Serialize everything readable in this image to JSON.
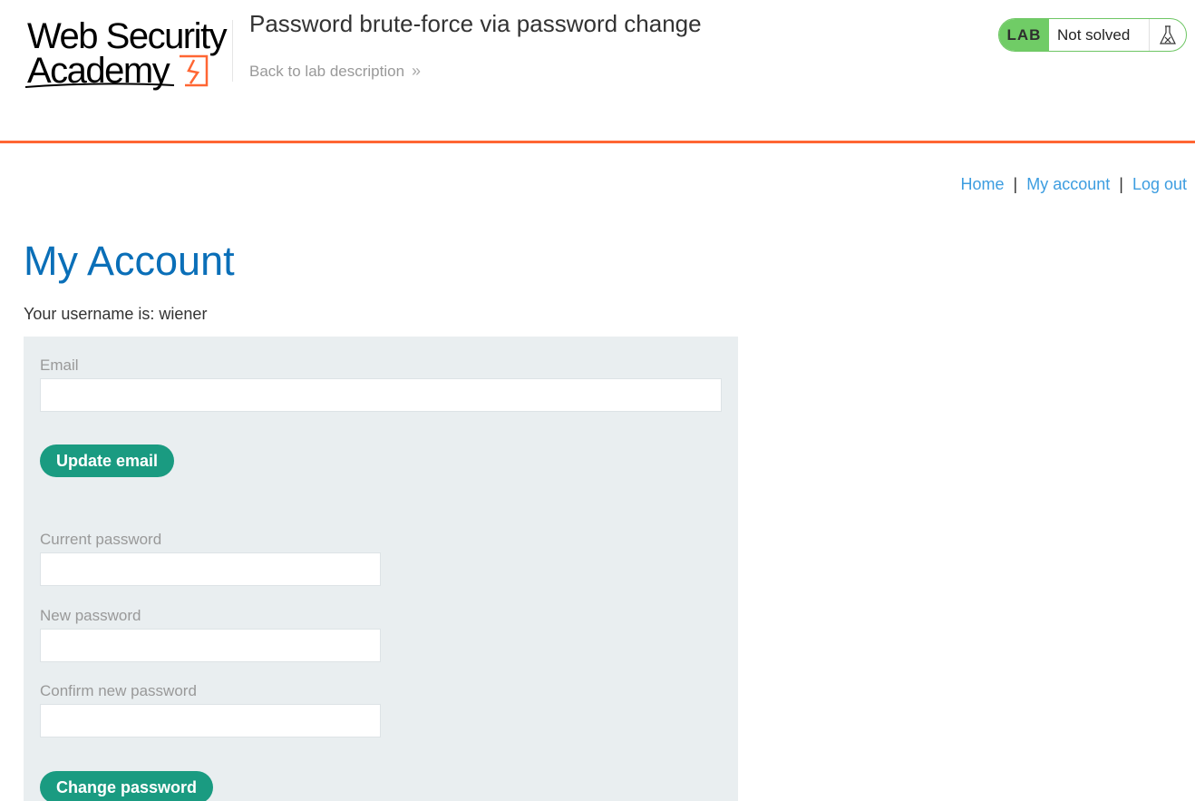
{
  "header": {
    "logo_line1": "Web Security",
    "logo_line2": "Academy",
    "lab_title": "Password brute-force via password change",
    "back_link": "Back to lab description",
    "back_chevron": "»",
    "lab_label": "LAB",
    "lab_status": "Not solved",
    "flask_icon": "flask-icon",
    "accent_color": "#ff6633",
    "status_color": "#70cc66"
  },
  "nav": {
    "home": "Home",
    "my_account": "My account",
    "log_out": "Log out",
    "separator": "|"
  },
  "page": {
    "title": "My Account",
    "username_text": "Your username is: wiener"
  },
  "email_form": {
    "email_label": "Email",
    "email_value": "",
    "submit": "Update email"
  },
  "password_form": {
    "current_label": "Current password",
    "new_label": "New password",
    "confirm_label": "Confirm new password",
    "submit": "Change password"
  }
}
